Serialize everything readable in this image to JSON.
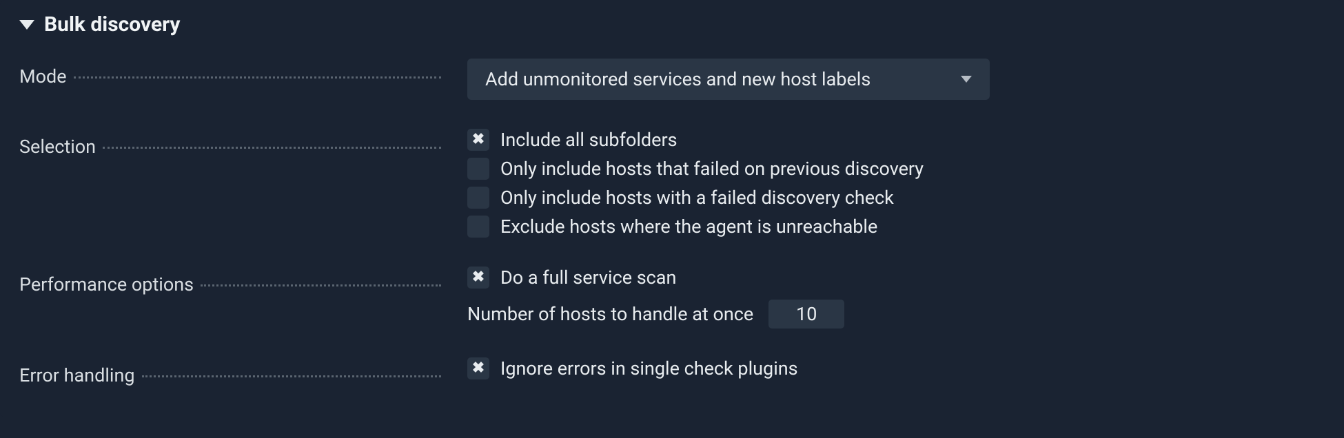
{
  "panel": {
    "title": "Bulk discovery"
  },
  "mode": {
    "label": "Mode",
    "value": "Add unmonitored services and new host labels"
  },
  "selection": {
    "label": "Selection",
    "options": [
      {
        "label": "Include all subfolders",
        "checked": true
      },
      {
        "label": "Only include hosts that failed on previous discovery",
        "checked": false
      },
      {
        "label": "Only include hosts with a failed discovery check",
        "checked": false
      },
      {
        "label": "Exclude hosts where the agent is unreachable",
        "checked": false
      }
    ]
  },
  "performance": {
    "label": "Performance options",
    "full_scan": {
      "label": "Do a full service scan",
      "checked": true
    },
    "hosts_at_once": {
      "label": "Number of hosts to handle at once",
      "value": "10"
    }
  },
  "error": {
    "label": "Error handling",
    "ignore": {
      "label": "Ignore errors in single check plugins",
      "checked": true
    }
  }
}
